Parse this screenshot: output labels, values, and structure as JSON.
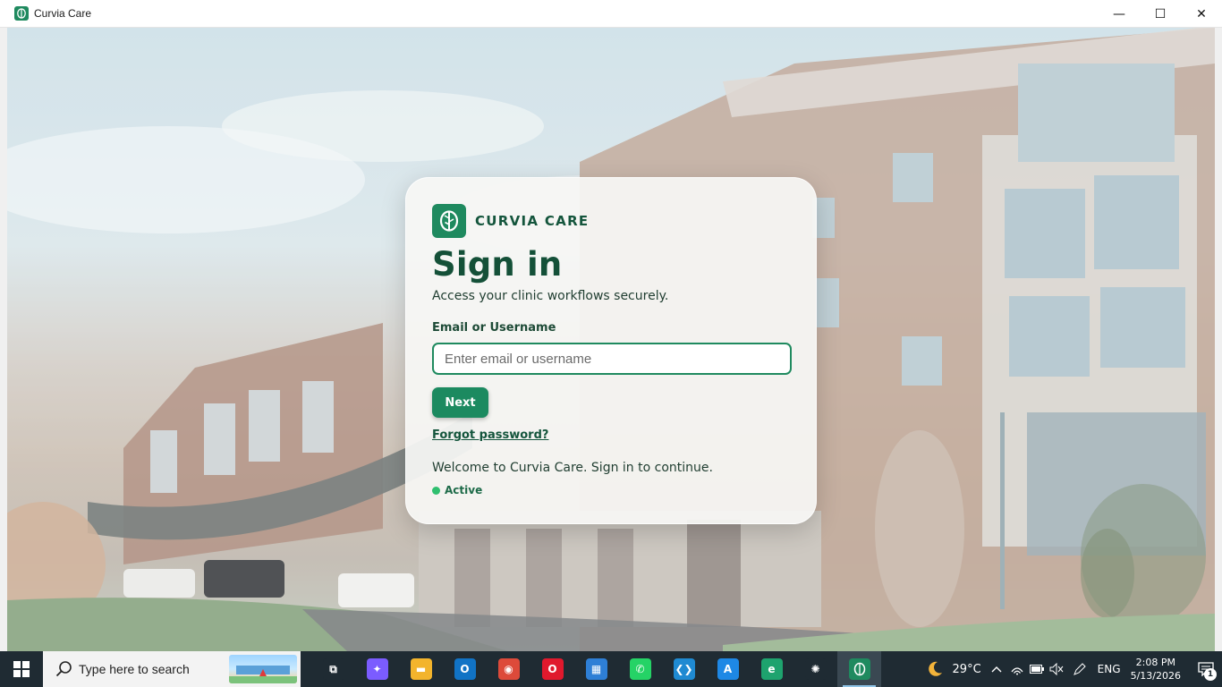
{
  "window": {
    "title": "Curvia Care",
    "icon": "leaf-logo-icon",
    "controls": {
      "minimize": "—",
      "maximize": "☐",
      "close": "✕"
    }
  },
  "card": {
    "brand_name": "CURVIA CARE",
    "heading": "Sign in",
    "subtitle": "Access your clinic workflows securely.",
    "field_label": "Email or Username",
    "field_placeholder": "Enter email or username",
    "field_value": "",
    "next_label": "Next",
    "forgot_label": "Forgot password?",
    "welcome_message": "Welcome to Curvia Care. Sign in to continue.",
    "status_label": "Active",
    "colors": {
      "brand": "#1f8a5f",
      "heading": "#145038",
      "status": "#2fbf6f"
    }
  },
  "taskbar": {
    "search_placeholder": "Type here to search",
    "apps": [
      {
        "name": "task-view-icon",
        "glyph": "⧉",
        "color": "#1f2b33"
      },
      {
        "name": "copilot-icon",
        "glyph": "✦",
        "color": "#7b5cff"
      },
      {
        "name": "file-explorer-icon",
        "glyph": "▬",
        "color": "#f3b42c"
      },
      {
        "name": "outlook-icon",
        "glyph": "O",
        "color": "#1173c5"
      },
      {
        "name": "chrome-icon",
        "glyph": "◉",
        "color": "#dd4a3a"
      },
      {
        "name": "opera-icon",
        "glyph": "O",
        "color": "#e0192d"
      },
      {
        "name": "microsoft-store-icon",
        "glyph": "▦",
        "color": "#2e7fd6"
      },
      {
        "name": "whatsapp-icon",
        "glyph": "✆",
        "color": "#25d366"
      },
      {
        "name": "vscode-icon",
        "glyph": "❮❯",
        "color": "#1f8ad2"
      },
      {
        "name": "app-store-icon",
        "glyph": "A",
        "color": "#1e88e5"
      },
      {
        "name": "edge-icon",
        "glyph": "e",
        "color": "#1ea36e"
      },
      {
        "name": "chatgpt-icon",
        "glyph": "✺",
        "color": "#1f2b33"
      },
      {
        "name": "curvia-care-taskbar-icon",
        "glyph": "",
        "color": "#1f8a5f",
        "active": true
      }
    ],
    "weather": "29°C",
    "language": "ENG",
    "time": "2:08 PM",
    "date": "5/13/2026",
    "notification_count": "1"
  }
}
